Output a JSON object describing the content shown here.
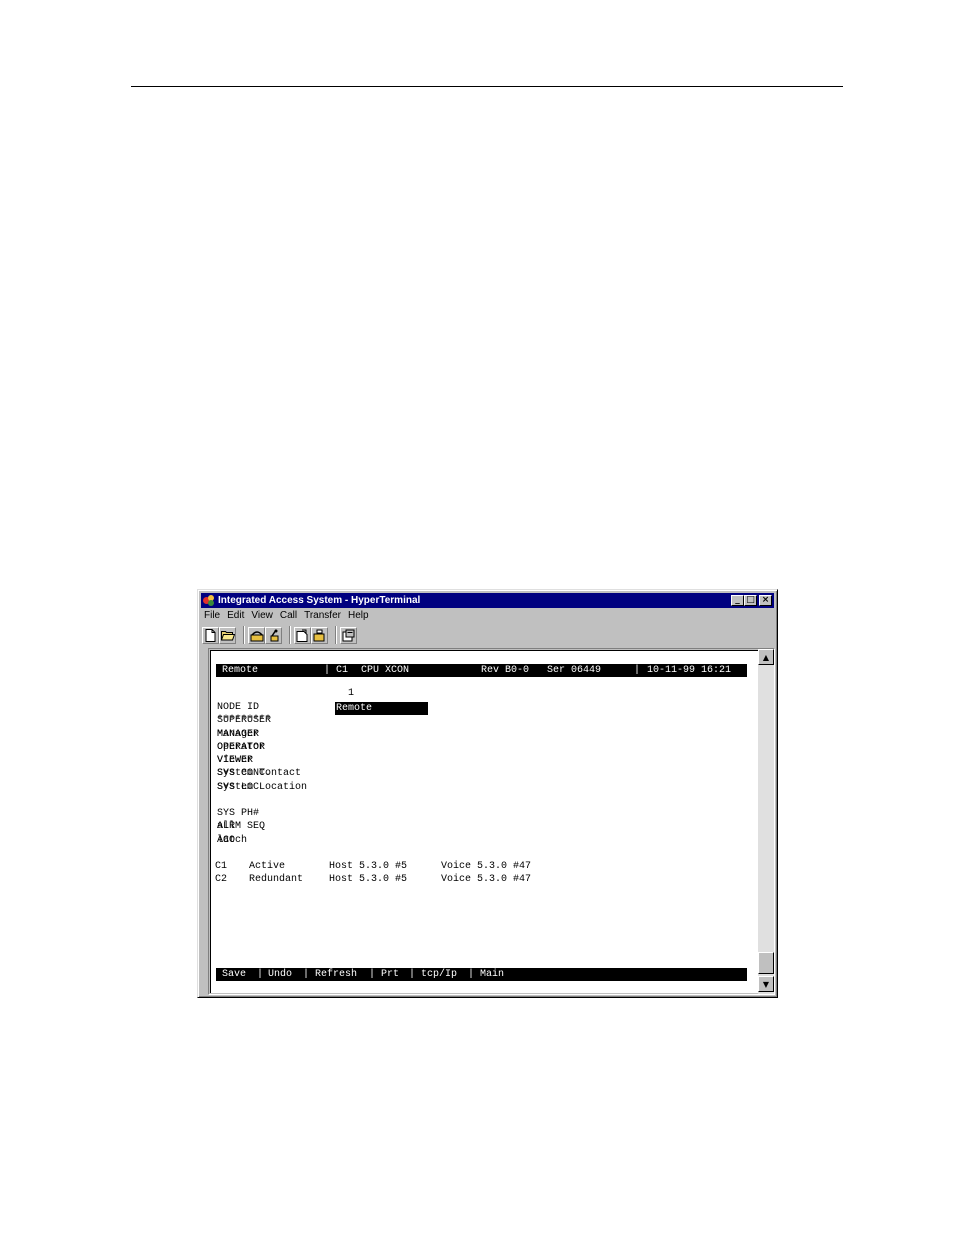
{
  "window": {
    "title": "Integrated Access System - HyperTerminal",
    "controls": {
      "minimize": "_",
      "maximize": "□",
      "close": "×"
    }
  },
  "menu": [
    "File",
    "Edit",
    "View",
    "Call",
    "Transfer",
    "Help"
  ],
  "toolbar": {
    "icons": [
      "new-icon",
      "open-icon",
      "connect-icon",
      "disconnect-icon",
      "send-icon",
      "receive-icon",
      "properties-icon"
    ]
  },
  "terminal": {
    "status": {
      "node": "Remote",
      "slot": "C1",
      "card": "CPU XCON",
      "rev": "Rev B0-0",
      "ser": "Ser 06449",
      "datetime": "10-11-99 16:21"
    },
    "column_header": "1",
    "fields": [
      {
        "label": "NODE ID",
        "value": "Remote"
      },
      {
        "label": "SUPERUSER",
        "value": "*********"
      },
      {
        "label": "MANAGER",
        "value": "Manager"
      },
      {
        "label": "OPERATOR",
        "value": "Operator"
      },
      {
        "label": "VIEWER",
        "value": "Viewer"
      },
      {
        "label": "SYS CONT.",
        "value": "System Contact"
      },
      {
        "label": "SYS LOC",
        "value": "System Location"
      },
      {
        "label": "SYS PH#",
        "value": ""
      },
      {
        "label": "ALRM SEQ",
        "value": "all"
      },
      {
        "label": "ACO",
        "value": "latch"
      }
    ],
    "cards": [
      {
        "slot": "C1",
        "state": "Active",
        "host": "Host 5.3.0 #5",
        "voice": "Voice 5.3.0 #47"
      },
      {
        "slot": "C2",
        "state": "Redundant",
        "host": "Host 5.3.0 #5",
        "voice": "Voice 5.3.0 #47"
      }
    ],
    "commands": [
      "Save",
      "Undo",
      "Refresh",
      "Prt",
      "tcp/Ip",
      "Main"
    ]
  }
}
